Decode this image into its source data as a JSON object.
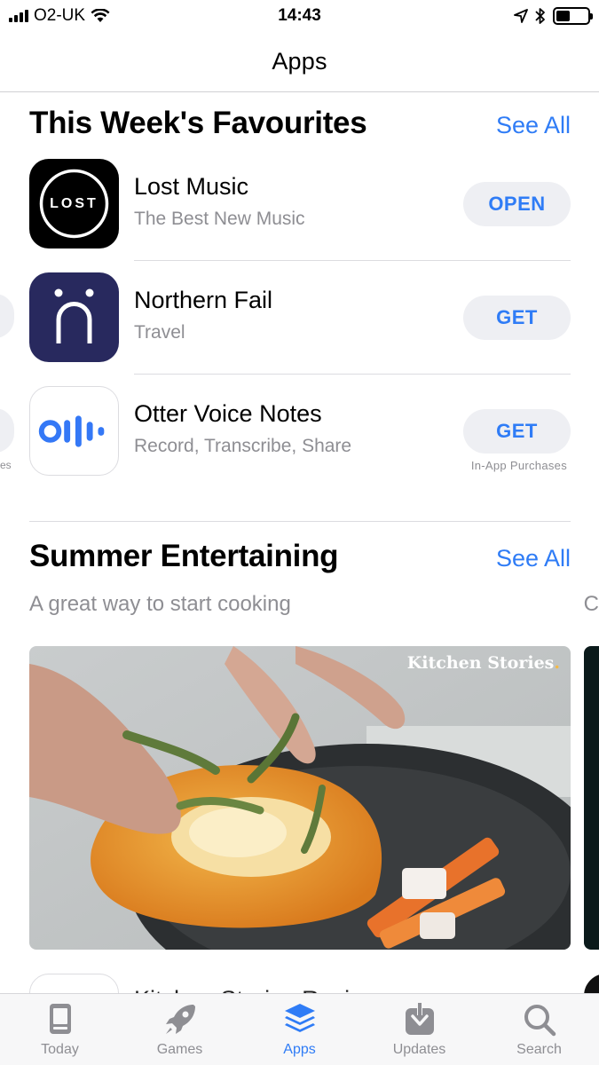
{
  "status_bar": {
    "carrier": "O2-UK",
    "time": "14:43",
    "battery_level": 0.45
  },
  "nav": {
    "title": "Apps"
  },
  "favourites": {
    "title": "This Week's Favourites",
    "see_all": "See All",
    "apps": [
      {
        "name": "Lost Music",
        "subtitle": "The Best New Music",
        "button": "OPEN",
        "icon": "lost-logo",
        "icon_text": "LOST"
      },
      {
        "name": "Northern Fail",
        "subtitle": "Travel",
        "button": "GET",
        "icon": "northern-fail-logo"
      },
      {
        "name": "Otter Voice Notes",
        "subtitle": "Record, Transcribe, Share",
        "button": "GET",
        "note": "In-App Purchases",
        "icon": "otter-logo"
      }
    ],
    "peek_text": "es"
  },
  "summer": {
    "title": "Summer Entertaining",
    "see_all": "See All",
    "subtitle": "A great way to start cooking",
    "peek_letter": "C",
    "feature": {
      "brand": "Kitchen Stories",
      "brand_dot": "."
    },
    "next_row_name": "Kitchen Stories Recipes"
  },
  "tabs": [
    {
      "label": "Today",
      "icon": "today-icon",
      "active": false
    },
    {
      "label": "Games",
      "icon": "rocket-icon",
      "active": false
    },
    {
      "label": "Apps",
      "icon": "stack-icon",
      "active": true
    },
    {
      "label": "Updates",
      "icon": "download-icon",
      "active": false
    },
    {
      "label": "Search",
      "icon": "search-icon",
      "active": false
    }
  ],
  "colors": {
    "accent": "#2f7cf6",
    "secondary_text": "#8e8e93",
    "button_bg": "#eeeff3",
    "northern_bg": "#28295e",
    "otter_blue": "#3478f6"
  }
}
